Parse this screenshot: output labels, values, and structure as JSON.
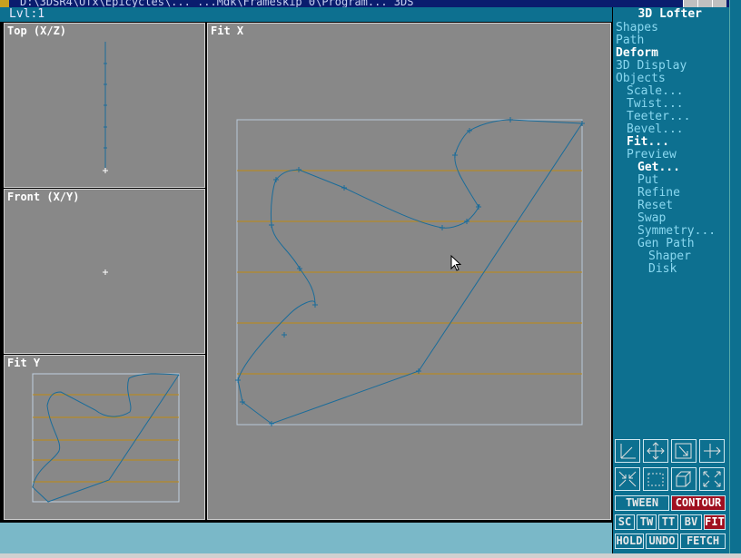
{
  "window": {
    "title": "D:\\3DSR4\\Ufx\\Epicycles\\... ...Mdk\\Frameskip 0\\Program... 3DS"
  },
  "status": {
    "level": "Lvl:1"
  },
  "panel": {
    "title": "3D Lofter",
    "menu": [
      {
        "label": "Shapes",
        "depth": 0,
        "active": false
      },
      {
        "label": "Path",
        "depth": 0,
        "active": false
      },
      {
        "label": "Deform",
        "depth": 0,
        "active": true
      },
      {
        "label": "3D Display",
        "depth": 0,
        "active": false
      },
      {
        "label": "Objects",
        "depth": 0,
        "active": false
      },
      {
        "label": "Scale...",
        "depth": 1,
        "active": false
      },
      {
        "label": "Twist...",
        "depth": 1,
        "active": false
      },
      {
        "label": "Teeter...",
        "depth": 1,
        "active": false
      },
      {
        "label": "Bevel...",
        "depth": 1,
        "active": false
      },
      {
        "label": "Fit...",
        "depth": 1,
        "active": true
      },
      {
        "label": "Preview",
        "depth": 1,
        "active": false
      },
      {
        "label": "Get...",
        "depth": 2,
        "active": true
      },
      {
        "label": "Put",
        "depth": 2,
        "active": false
      },
      {
        "label": "Refine",
        "depth": 2,
        "active": false
      },
      {
        "label": "Reset",
        "depth": 2,
        "active": false
      },
      {
        "label": "Swap",
        "depth": 2,
        "active": false
      },
      {
        "label": "Symmetry...",
        "depth": 2,
        "active": false
      },
      {
        "label": "Gen Path",
        "depth": 2,
        "active": false
      },
      {
        "label": "Shaper",
        "depth": 3,
        "active": false
      },
      {
        "label": "Disk",
        "depth": 3,
        "active": false
      }
    ],
    "toolbar_icons": [
      "axis-tripod",
      "pan",
      "zoom-window",
      "arrow-right",
      "zoom-in",
      "region",
      "3d-box",
      "zoom-extents"
    ],
    "mode_buttons": [
      {
        "label": "TWEEN",
        "on": false
      },
      {
        "label": "CONTOUR",
        "on": true
      }
    ],
    "small_buttons": [
      {
        "label": "SC",
        "on": false
      },
      {
        "label": "TW",
        "on": false
      },
      {
        "label": "TT",
        "on": false
      },
      {
        "label": "BV",
        "on": false
      },
      {
        "label": "FIT",
        "on": true
      }
    ],
    "action_buttons": [
      {
        "label": "HOLD"
      },
      {
        "label": "UNDO"
      },
      {
        "label": "FETCH"
      }
    ]
  },
  "viewports": {
    "top": {
      "label": "Top (X/Z)"
    },
    "front": {
      "label": "Front (X/Y)"
    },
    "fity": {
      "label": "Fit Y"
    },
    "fitx": {
      "label": "Fit X"
    }
  },
  "colors": {
    "curve": "#1a6c9a",
    "grid": "#c08a10",
    "viewport_bg": "#888888",
    "panel_bg": "#0d7090",
    "active_button": "#a01020"
  }
}
